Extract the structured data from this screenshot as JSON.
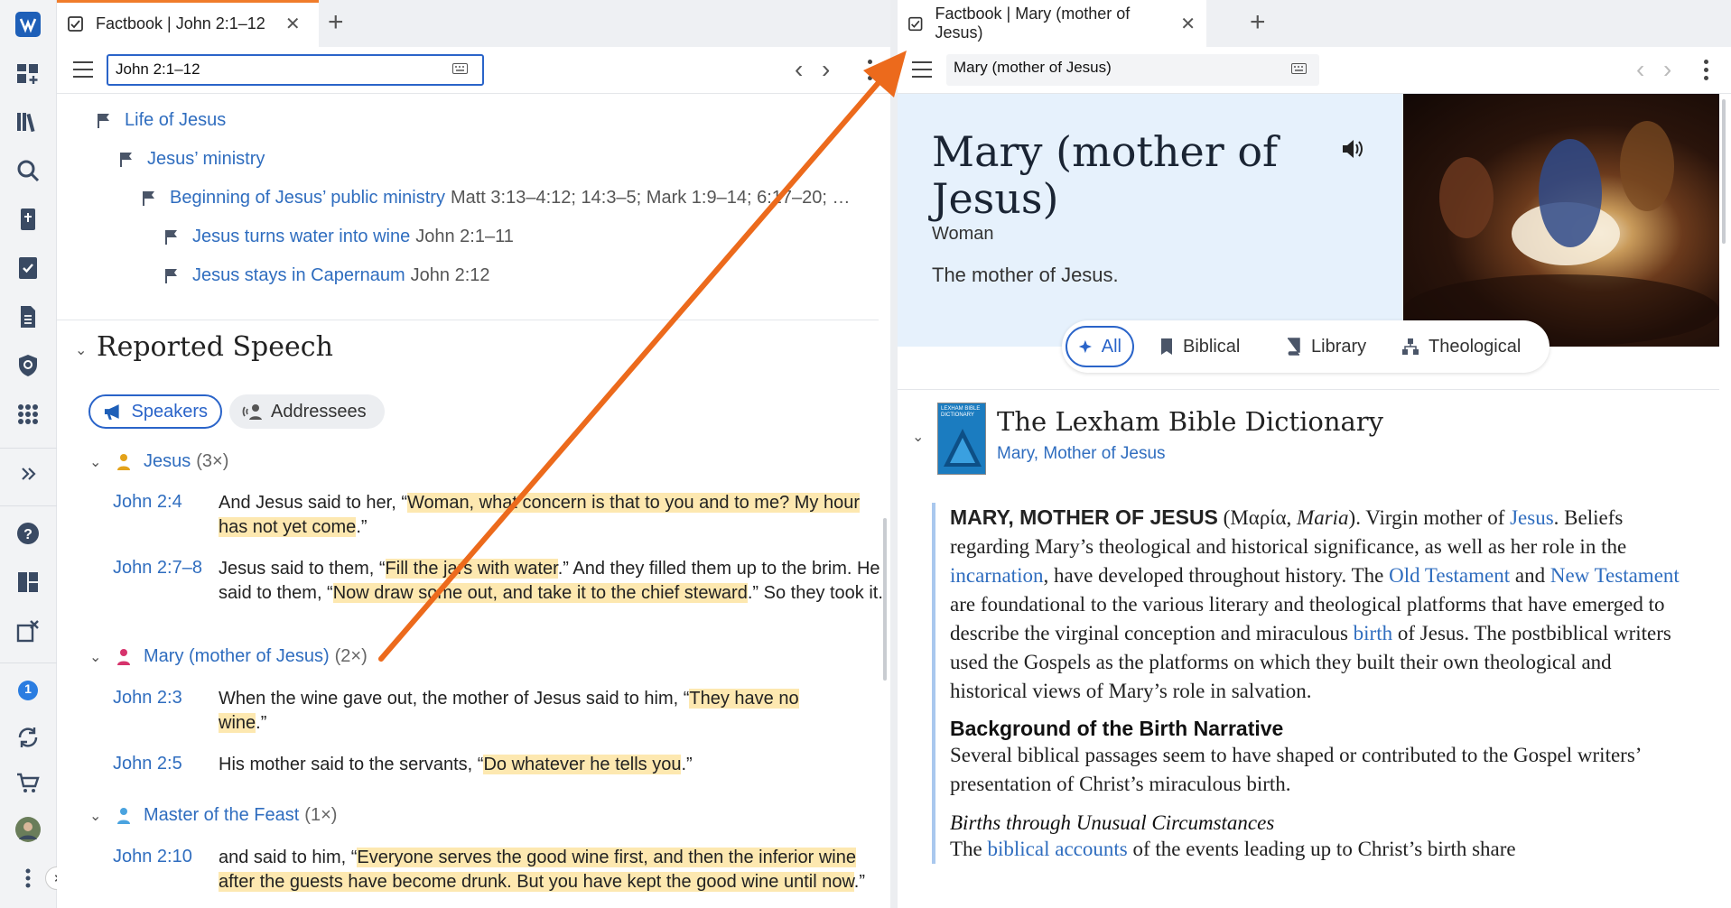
{
  "left_panel": {
    "tab_title": "Factbook | John 2:1–12",
    "address": "John 2:1–12",
    "outline": [
      {
        "label": "Life of Jesus",
        "ref": ""
      },
      {
        "label": "Jesus’ ministry",
        "ref": ""
      },
      {
        "label": "Beginning of Jesus’ public ministry",
        "ref": "Matt 3:13–4:12; 14:3–5; Mark 1:9–14; 6:17–20; …"
      },
      {
        "label": "Jesus turns water into wine",
        "ref": "John 2:1–11"
      },
      {
        "label": "Jesus stays in Capernaum",
        "ref": "John 2:12"
      }
    ],
    "reported_speech": {
      "title": "Reported Speech",
      "tabs": [
        "Speakers",
        "Addressees"
      ],
      "speakers": [
        {
          "name": "Jesus",
          "count": "(3×)",
          "color": "#e3a21a"
        },
        {
          "name": "Mary (mother of Jesus)",
          "count": "(2×)",
          "color": "#d6336c"
        },
        {
          "name": "Master of the Feast",
          "count": "(1×)",
          "color": "#4aa3df"
        }
      ],
      "verses": [
        {
          "ref": "John 2:4",
          "pre": "And Jesus said to her, “",
          "hl": "Woman, what concern is that to you and to me? My hour has not yet come",
          "post": ".”"
        },
        {
          "ref": "John 2:7–8",
          "pre": "Jesus said to them, “",
          "hl": "Fill the jars with water",
          "mid": ".” And they filled them up to the brim. He said to them, “",
          "hl2": "Now draw some out, and take it to the chief steward",
          "post": ".” So they took it."
        },
        {
          "ref": "John 2:3",
          "pre": "When the wine gave out, the mother of Jesus said to him, “",
          "hl": "They have no wine",
          "post": ".”"
        },
        {
          "ref": "John 2:5",
          "pre": "His mother said to the servants, “",
          "hl": "Do whatever he tells you",
          "post": ".”"
        },
        {
          "ref": "John 2:10",
          "pre": "and said to him, “",
          "hl": "Everyone serves the good wine first, and then the inferior wine after the guests have become drunk. But you have kept the good wine until now",
          "post": ".”"
        }
      ]
    }
  },
  "right_panel": {
    "tab_title": "Factbook | Mary (mother of Jesus)",
    "address": "Mary (mother of Jesus)",
    "hero": {
      "title": "Mary (mother of Jesus)",
      "type": "Woman",
      "description": "The mother of Jesus."
    },
    "filters": [
      "All",
      "Biblical",
      "Library",
      "Theological"
    ],
    "resource": {
      "title": "The Lexham Bible Dictionary",
      "article": "Mary, Mother of Jesus",
      "cover_text": "LEXHAM BIBLE DICTIONARY"
    },
    "article": {
      "headword": "MARY, MOTHER OF JESUS",
      "greek": "Μαρία",
      "translit": "Maria",
      "p1_a": "). Virgin mother of ",
      "link_jesus": "Jesus",
      "p1_b": ". Beliefs regarding Mary’s theological and historical significance, as well as her role in the ",
      "link_incarnation": "incarnation",
      "p1_c": ", have developed throughout history. The ",
      "link_ot": "Old Testament",
      "p1_d": " and ",
      "link_nt": "New Testament",
      "p1_e": " are foundational to the various literary and theological platforms that have emerged to describe the virginal conception and miraculous ",
      "link_birth": "birth",
      "p1_f": " of Jesus. The postbiblical writers used the Gospels as the platforms on which they built their own theological and historical views of Mary’s role in salvation.",
      "h2": "Background of the Birth Narrative",
      "p2": "Several biblical passages seem to have shaped or contributed to the Gospel writers’ presentation of Christ’s miraculous birth.",
      "h3": "Births through Unusual Circumstances",
      "p3_a": "The ",
      "link_accounts": "biblical accounts",
      "p3_b": " of the events leading up to Christ’s birth share"
    }
  },
  "rail": {
    "notification_count": "1"
  },
  "colors": {
    "accent": "#2a64c9",
    "link": "#2f6dbf",
    "highlight": "#fde8b0",
    "arrow": "#ec6a1c",
    "tab_accent": "#f07c2a"
  }
}
